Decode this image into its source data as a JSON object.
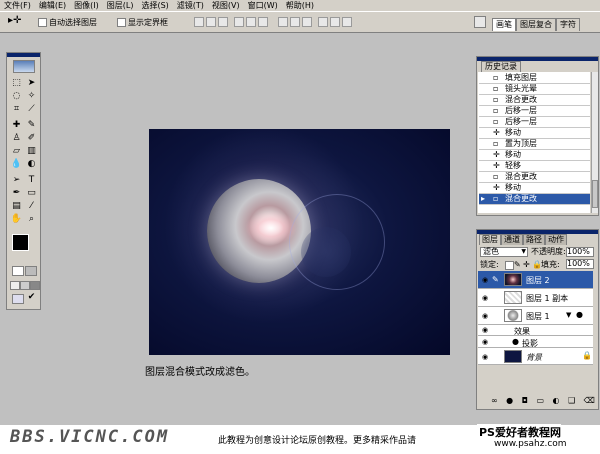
{
  "menu": [
    "文件(F)",
    "编辑(E)",
    "图像(I)",
    "图层(L)",
    "选择(S)",
    "滤镜(T)",
    "视图(V)",
    "窗口(W)",
    "帮助(H)"
  ],
  "options": {
    "auto_select": "自动选择图层",
    "show_bounds": "显示定界框"
  },
  "palette_tabs": [
    "画笔",
    "图层复合",
    "字符"
  ],
  "caption": "图层混合模式改成滤色。",
  "history": {
    "title": "历史记录",
    "items": [
      "填充图层",
      "镜头光晕",
      "混合更改",
      "后移一层",
      "后移一层",
      "移动",
      "置为顶层",
      "移动",
      "轻移",
      "混合更改",
      "移动",
      "混合更改"
    ],
    "selected_index": 11
  },
  "layers": {
    "tabs": [
      "图层",
      "通道",
      "路径",
      "动作"
    ],
    "blend_mode": "滤色",
    "opacity_label": "不透明度:",
    "opacity_value": "100%",
    "lock_label": "锁定:",
    "fill_label": "填充:",
    "fill_value": "100%",
    "rows": [
      {
        "name": "图层 2",
        "type": "layer",
        "selected": true
      },
      {
        "name": "图层 1 副本",
        "type": "layer",
        "selected": false
      },
      {
        "name": "图层 1",
        "type": "layer",
        "selected": false
      },
      {
        "name": "效果",
        "type": "effect",
        "selected": false
      },
      {
        "name": "投影",
        "type": "effect",
        "selected": false
      },
      {
        "name": "背景",
        "type": "background",
        "selected": false
      }
    ]
  },
  "footer": {
    "left_logo": "BBS.VICNC.COM",
    "note": "此教程为创意设计论坛原创教程。更多精采作品请",
    "right_logo": "PS爱好者教程网",
    "right_url": "www.psahz.com"
  },
  "colors": {
    "selection": "#2c59a8",
    "panel_bg": "#d4d0c8",
    "workspace": "#c0c0c0",
    "canvas_bg": "#0e1640"
  }
}
